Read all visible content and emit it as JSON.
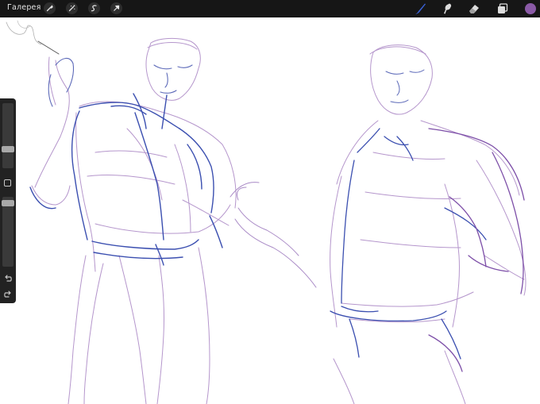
{
  "topbar": {
    "gallery_label": "Галерея",
    "left_tools": [
      "wrench-icon",
      "magic-wand-icon",
      "selection-icon",
      "transform-arrow-icon"
    ],
    "right_tools": [
      "brush-icon",
      "smudge-icon",
      "eraser-icon",
      "layers-icon"
    ],
    "active_tool": "brush-icon",
    "active_tool_color": "#3a62d9",
    "current_color": "#8a5aa6"
  },
  "sidebar": {
    "brush_size_level": 0.5,
    "opacity_level": 0.35,
    "buttons": [
      "modify-icon",
      "undo-icon",
      "redo-icon"
    ]
  },
  "canvas": {
    "content": "sketch-artwork",
    "stroke_colors": [
      "#3b4fb0",
      "#a98ac6",
      "#7d6ab6"
    ]
  }
}
